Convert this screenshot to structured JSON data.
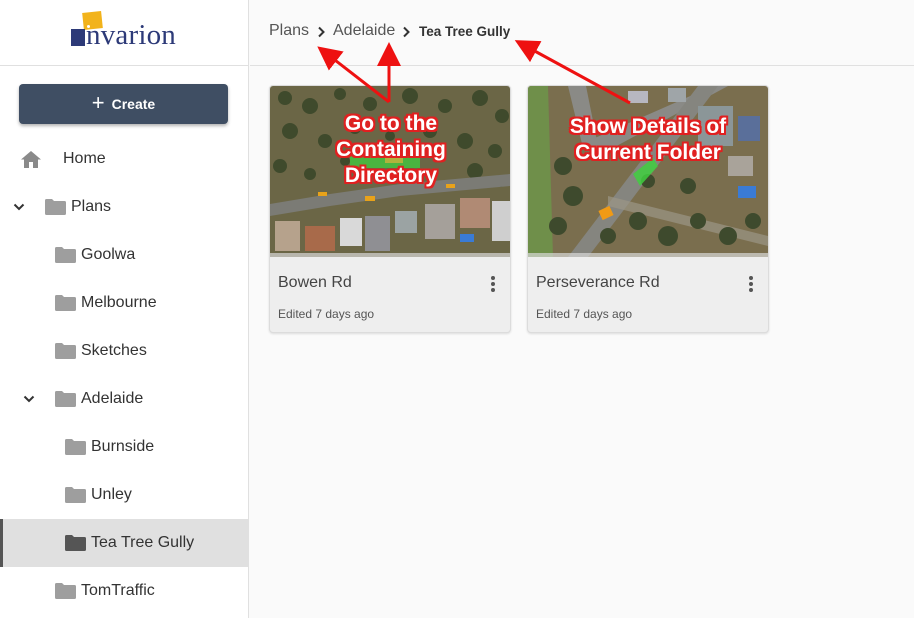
{
  "app": {
    "logo_text": "nvarion",
    "brand_colors": {
      "navy": "#2d3a78",
      "yellow": "#f2b31b"
    }
  },
  "sidebar": {
    "create_label": "Create",
    "create_color": "#3f4e63",
    "items": [
      {
        "label": "Home",
        "icon": "home-icon"
      },
      {
        "label": "Plans",
        "icon": "folder-icon",
        "expanded": true
      },
      {
        "label": "Goolwa",
        "icon": "folder-icon"
      },
      {
        "label": "Melbourne",
        "icon": "folder-icon"
      },
      {
        "label": "Sketches",
        "icon": "folder-icon"
      },
      {
        "label": "Adelaide",
        "icon": "folder-icon",
        "expanded": true
      },
      {
        "label": "Burnside",
        "icon": "folder-icon"
      },
      {
        "label": "Unley",
        "icon": "folder-icon"
      },
      {
        "label": "Tea Tree Gully",
        "icon": "folder-icon",
        "active": true
      },
      {
        "label": "TomTraffic",
        "icon": "folder-icon"
      }
    ]
  },
  "breadcrumb": {
    "items": [
      "Plans",
      "Adelaide"
    ],
    "current": "Tea Tree Gully"
  },
  "cards": [
    {
      "title": "Bowen Rd",
      "subtitle": "Edited 7 days ago"
    },
    {
      "title": "Perseverance Rd",
      "subtitle": "Edited 7 days ago"
    }
  ],
  "annotations": {
    "left": [
      "Go to the",
      "Containing",
      "Directory"
    ],
    "right": [
      "Show Details of",
      "Current Folder"
    ],
    "color": "#e02020"
  }
}
